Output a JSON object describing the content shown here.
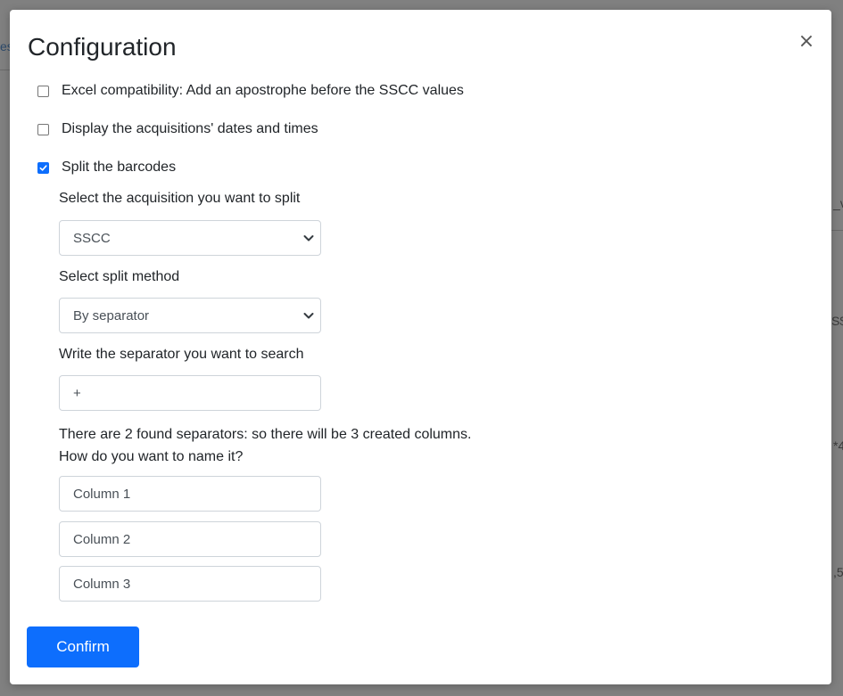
{
  "background": {
    "fragments": [
      "es",
      "_v",
      "S$",
      "*4",
      ",5"
    ]
  },
  "dialog": {
    "title": "Configuration",
    "close_glyph": "×",
    "options": [
      {
        "label": "Excel compatibility: Add an apostrophe before the SSCC values",
        "checked": false
      },
      {
        "label": "Display the acquisitions' dates and times",
        "checked": false
      },
      {
        "label": "Split the barcodes",
        "checked": true
      }
    ],
    "split": {
      "acquisition_label": "Select the acquisition you want to split",
      "acquisition_value": "SSCC",
      "method_label": "Select split method",
      "method_value": "By separator",
      "separator_label": "Write the separator you want to search",
      "separator_value": "+",
      "info_line1": "There are 2 found separators: so there will be 3 created columns.",
      "info_line2": "How do you want to name it?",
      "columns": [
        "Column 1",
        "Column 2",
        "Column 3"
      ]
    },
    "confirm_label": "Confirm"
  },
  "colors": {
    "accent": "#0d6efd",
    "overlay": "#808080"
  },
  "icons": {
    "close": "close-icon",
    "checkbox_checked": "checkmark-icon",
    "select": "chevron-down-icon"
  }
}
